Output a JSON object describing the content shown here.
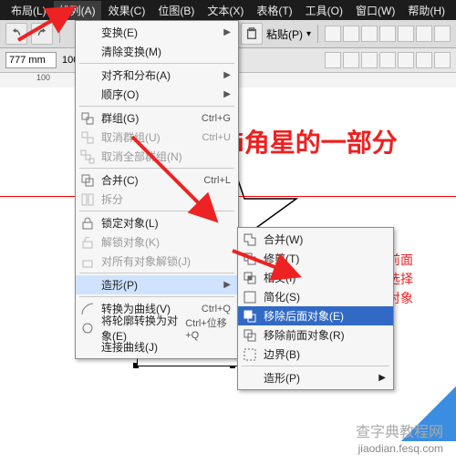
{
  "menubar": {
    "items": [
      {
        "label": "布局(L)"
      },
      {
        "label": "排列(A)"
      },
      {
        "label": "效果(C)"
      },
      {
        "label": "位图(B)"
      },
      {
        "label": "文本(X)"
      },
      {
        "label": "表格(T)"
      },
      {
        "label": "工具(O)"
      },
      {
        "label": "窗口(W)"
      },
      {
        "label": "帮助(H)"
      }
    ],
    "active_index": 1
  },
  "propbar": {
    "size": "777 mm",
    "paste_label": "粘贴(P)",
    "units": "100"
  },
  "menu": {
    "groups": [
      [
        {
          "label": "变换(E)",
          "has_sub": true
        },
        {
          "label": "清除变换(M)"
        }
      ],
      [
        {
          "label": "对齐和分布(A)",
          "has_sub": true
        },
        {
          "label": "顺序(O)",
          "has_sub": true
        }
      ],
      [
        {
          "label": "群组(G)",
          "shortcut": "Ctrl+G",
          "icon": "group-icon"
        },
        {
          "label": "取消群组(U)",
          "shortcut": "Ctrl+U",
          "disabled": true,
          "icon": "ungroup-icon"
        },
        {
          "label": "取消全部群组(N)",
          "disabled": true,
          "icon": "ungroup-all-icon"
        }
      ],
      [
        {
          "label": "合并(C)",
          "shortcut": "Ctrl+L",
          "icon": "combine-icon"
        },
        {
          "label": "拆分",
          "disabled": true,
          "icon": "break-icon"
        }
      ],
      [
        {
          "label": "锁定对象(L)",
          "icon": "lock-icon"
        },
        {
          "label": "解锁对象(K)",
          "disabled": true,
          "icon": "unlock-icon"
        },
        {
          "label": "对所有对象解锁(J)",
          "disabled": true,
          "icon": "unlock-all-icon"
        }
      ],
      [
        {
          "label": "造形(P)",
          "has_sub": true,
          "hover": true
        }
      ],
      [
        {
          "label": "转换为曲线(V)",
          "shortcut": "Ctrl+Q",
          "icon": "to-curve-icon"
        },
        {
          "label": "将轮廓转换为对象(E)",
          "shortcut": "Ctrl+位移+Q",
          "icon": "outline-to-object-icon"
        },
        {
          "label": "连接曲线(J)"
        }
      ]
    ]
  },
  "submenu": {
    "items": [
      {
        "label": "合并(W)",
        "icon": "weld-icon"
      },
      {
        "label": "修剪(T)",
        "icon": "trim-icon"
      },
      {
        "label": "相交(I)",
        "icon": "intersect-icon"
      },
      {
        "label": "简化(S)",
        "icon": "simplify-icon"
      },
      {
        "label": "移除后面对象(E)",
        "icon": "remove-back-icon",
        "highlight": true
      },
      {
        "label": "移除前面对象(R)",
        "icon": "remove-front-icon"
      },
      {
        "label": "边界(B)",
        "icon": "boundary-icon"
      }
    ],
    "footer": {
      "label": "造形(P)",
      "has_sub": true
    }
  },
  "annotations": {
    "title_red": "i角星的一部分",
    "note_line1": "看五角星在前面",
    "note_line2": "还是后面，选择",
    "note_line3": "对应移除的对象"
  },
  "ruler": {
    "tick": "100"
  },
  "watermark": {
    "line1": "查字典教程网",
    "line2": "jiaodian.fesq.com"
  }
}
